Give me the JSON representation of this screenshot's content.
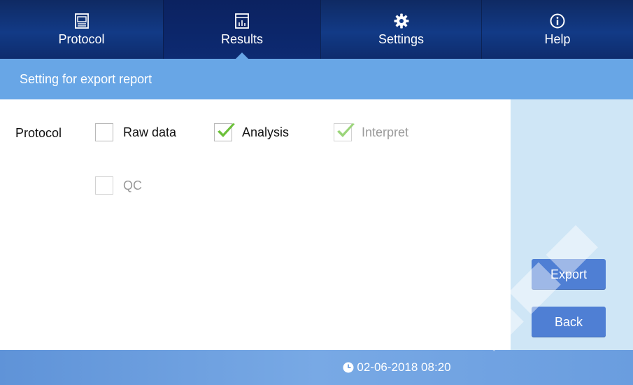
{
  "nav": {
    "tabs": [
      {
        "label": "Protocol",
        "icon": "window-icon",
        "active": false
      },
      {
        "label": "Results",
        "icon": "chart-icon",
        "active": true
      },
      {
        "label": "Settings",
        "icon": "gear-icon",
        "active": false
      },
      {
        "label": "Help",
        "icon": "info-icon",
        "active": false
      }
    ]
  },
  "header": {
    "title": "Setting for export report"
  },
  "form": {
    "row_label": "Protocol",
    "options": [
      {
        "label": "Raw data",
        "checked": false,
        "enabled": true
      },
      {
        "label": "Analysis",
        "checked": true,
        "enabled": true
      },
      {
        "label": "Interpret",
        "checked": true,
        "enabled": false
      },
      {
        "label": "QC",
        "checked": false,
        "enabled": false
      }
    ]
  },
  "actions": {
    "export_label": "Export",
    "back_label": "Back"
  },
  "footer": {
    "datetime": "02-06-2018 08:20"
  },
  "colors": {
    "nav_bg": "#123a86",
    "header_bg": "#68a6e6",
    "button_bg": "#4f7fd4",
    "side_bg": "#cfe6f6",
    "check_green": "#6cc13a"
  }
}
